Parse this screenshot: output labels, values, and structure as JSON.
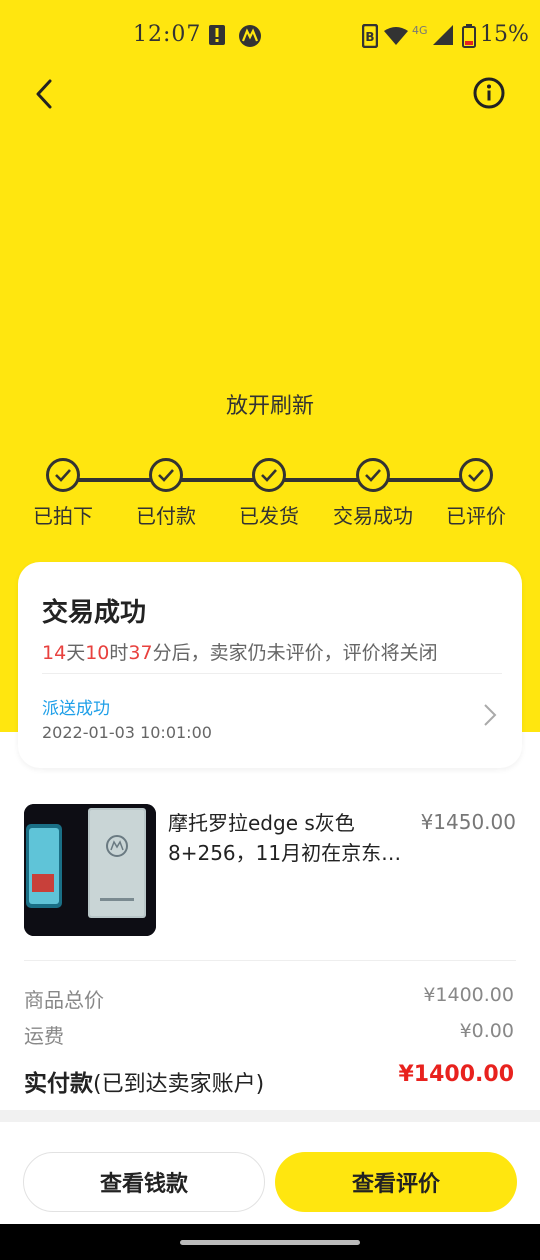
{
  "status_bar": {
    "time": "12:07",
    "battery": "15%",
    "network": "4G",
    "icons": [
      "alert-icon",
      "motorola-icon",
      "nfc-icon",
      "wifi-icon",
      "signal-icon",
      "battery-icon"
    ]
  },
  "header": {
    "back_icon": "chevron-left-icon",
    "info_icon": "info-icon"
  },
  "refresh_hint": "放开刷新",
  "progress_steps": [
    {
      "label": "已拍下",
      "done": true
    },
    {
      "label": "已付款",
      "done": true
    },
    {
      "label": "已发货",
      "done": true
    },
    {
      "label": "交易成功",
      "done": true
    },
    {
      "label": "已评价",
      "done": true
    }
  ],
  "status_card": {
    "title": "交易成功",
    "countdown": {
      "days": "14",
      "days_unit": "天",
      "hours": "10",
      "hours_unit": "时",
      "minutes": "37",
      "minutes_suffix": "分后，卖家仍未评价，评价将关闭"
    },
    "delivery_status": "派送成功",
    "delivery_time": "2022-01-03 10:01:00"
  },
  "product": {
    "title": "摩托罗拉edge s灰色8+256，11月初在京东…",
    "price": "¥1450.00"
  },
  "summary": {
    "items_total_label": "商品总价",
    "items_total_value": "¥1400.00",
    "shipping_label": "运费",
    "shipping_value": "¥0.00",
    "paid_label": "实付款",
    "paid_note": "(已到达卖家账户)",
    "paid_value": "¥1400.00"
  },
  "actions": {
    "view_payment": "查看钱款",
    "view_review": "查看评价"
  },
  "colors": {
    "brand_yellow": "#FFE60F",
    "countdown_red": "#E8413E",
    "link_blue": "#1E9FE8",
    "price_red": "#E8221E"
  }
}
